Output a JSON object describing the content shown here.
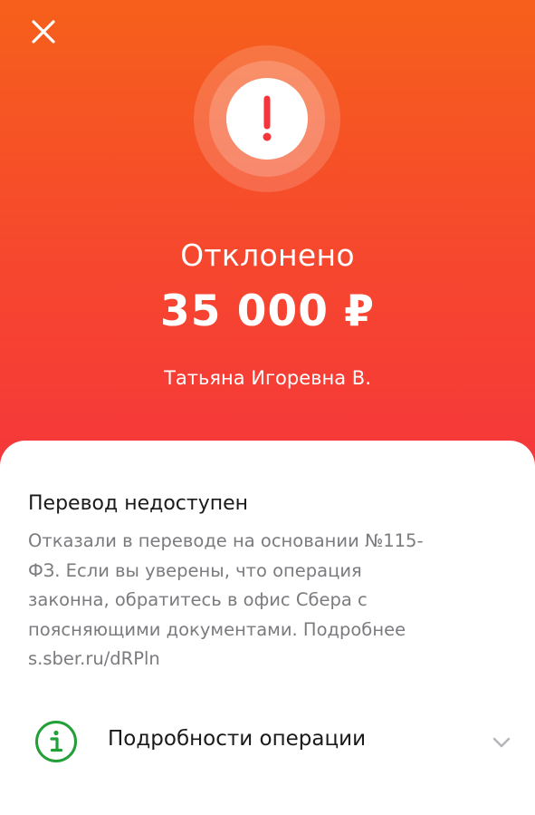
{
  "header": {
    "close_icon": "close-icon",
    "status_icon": "exclamation-icon",
    "status_title": "Отклонено",
    "amount": "35 000 ₽",
    "recipient": "Татьяна Игоревна В."
  },
  "notice": {
    "title": "Перевод недоступен",
    "text": "Отказали в переводе на основании №115-\nФЗ. Если вы уверены, что операция\nзаконна, обратитесь в офис Сбера с\nпоясняющими документами. Подробнее\ns.sber.ru/dRPln"
  },
  "details": {
    "icon": "info-icon",
    "label": "Подробности операции",
    "chevron_icon": "chevron-down-icon"
  },
  "colors": {
    "gradient_top": "#f6601b",
    "gradient_bottom": "#f5343c",
    "info_green": "#21a038",
    "status_red": "#f5343c"
  }
}
